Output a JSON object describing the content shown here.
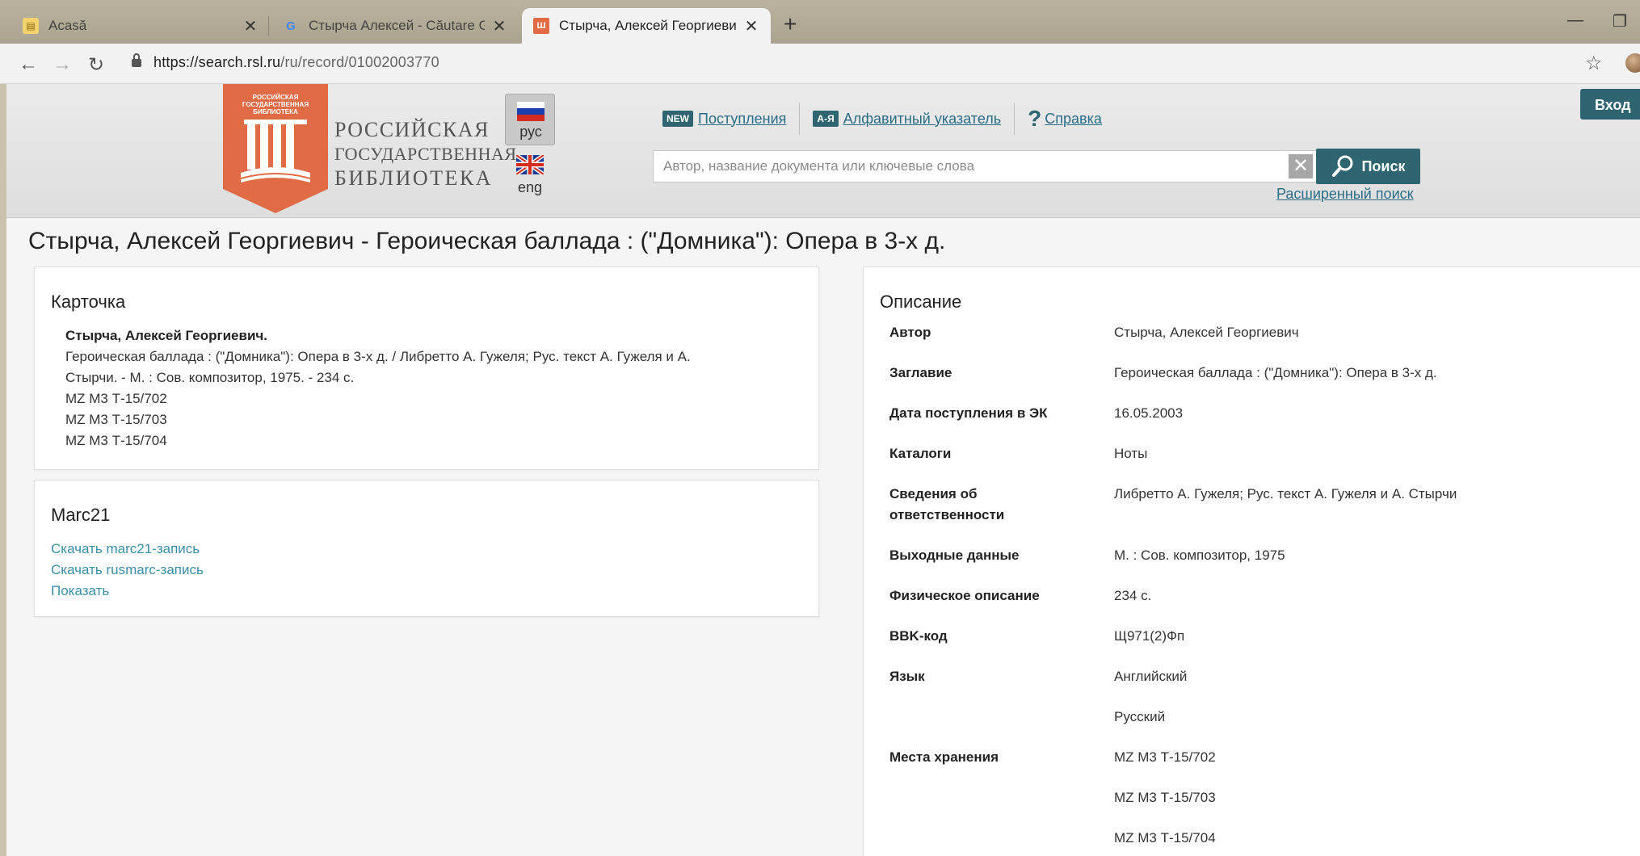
{
  "browser": {
    "tabs": [
      {
        "title": "Acasă",
        "favicon": "yellow-note-icon"
      },
      {
        "title": "Стырча Алексей - Căutare Goog",
        "favicon": "google-icon"
      },
      {
        "title": "Стырча, Алексей Георгиевич - ",
        "favicon": "rsl-icon"
      }
    ],
    "url_host": "https://search.rsl.ru",
    "url_path": "/ru/record/01002003770"
  },
  "header": {
    "logo_lines": [
      "РОССИЙСКАЯ",
      "ГОСУДАРСТВЕННАЯ",
      "БИБЛИОТЕКА"
    ],
    "logo_badge_lines": [
      "РОССИЙСКАЯ",
      "ГОСУДАРСТВЕННАЯ",
      "БИБЛИОТЕКА"
    ],
    "lang_ru": "рус",
    "lang_en": "eng",
    "nav": {
      "new_badge": "NEW",
      "arrivals": "Поступления",
      "az_badge": "А-Я",
      "alphabetical": "Алфавитный указатель",
      "help_icon": "?",
      "help": "Справка"
    },
    "search_placeholder": "Автор, название документа или ключевые слова",
    "search_button": "Поиск",
    "advanced_search": "Расширенный поиск",
    "login": "Вход"
  },
  "record": {
    "title": "Стырча, Алексей Георгиевич - Героическая баллада : (\"Домника\"): Опера в 3-х д."
  },
  "card": {
    "heading": "Карточка",
    "author": "Стырча, Алексей Георгиевич.",
    "line1": "Героическая баллада : (\"Домника\"): Опера в 3-х д. / Либретто А. Гужеля; Рус. текст А. Гужеля и А.",
    "line2": "Стырчи. - М. : Сов. композитор, 1975. - 234 с.",
    "shelf": [
      "MZ M3 Т-15/702",
      "MZ M3 Т-15/703",
      "MZ M3 Т-15/704"
    ]
  },
  "marc": {
    "heading": "Marc21",
    "download_marc21": "Скачать marc21-запись",
    "download_rusmarc": "Скачать rusmarc-запись",
    "show": "Показать"
  },
  "description": {
    "heading": "Описание",
    "rows": [
      {
        "key": "Автор",
        "value": "Стырча, Алексей Георгиевич"
      },
      {
        "key": "Заглавие",
        "value": "Героическая баллада : (\"Домника\"): Опера в 3-х д."
      },
      {
        "key": "Дата поступления в ЭК",
        "value": "16.05.2003"
      },
      {
        "key": "Каталоги",
        "value": "Ноты"
      },
      {
        "key": "Сведения об ответственности",
        "value": "Либретто А. Гужеля; Рус. текст А. Гужеля и А. Стырчи"
      },
      {
        "key": "Выходные данные",
        "value": "М. : Сов. композитор, 1975"
      },
      {
        "key": "Физическое описание",
        "value": "234 с."
      },
      {
        "key": "BBK-код",
        "value": "Щ971(2)Фп"
      },
      {
        "key": "Язык",
        "value": "Английский"
      },
      {
        "key": "",
        "value": "Русский"
      },
      {
        "key": "Места хранения",
        "value": "MZ M3 Т-15/702"
      },
      {
        "key": "",
        "value": "MZ M3 Т-15/703"
      },
      {
        "key": "",
        "value": "MZ M3 Т-15/704"
      }
    ]
  },
  "colors": {
    "brand_teal": "#2f6570",
    "link": "#2a6d86",
    "logo_orange": "#e06b45"
  }
}
